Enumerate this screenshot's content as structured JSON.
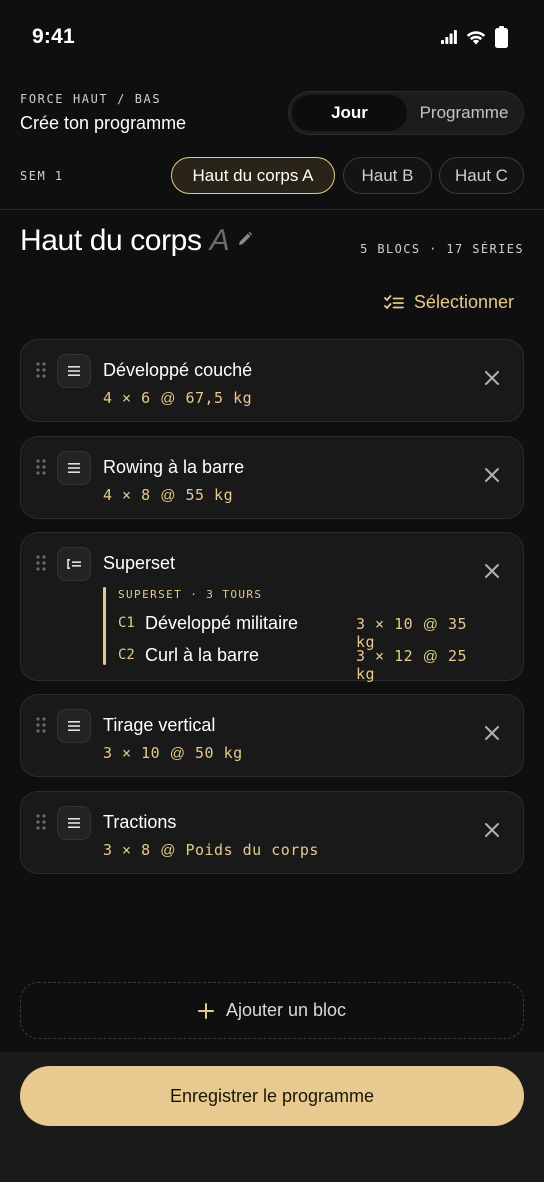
{
  "status": {
    "time": "9:41"
  },
  "header": {
    "eyebrow": "FORCE HAUT / BAS",
    "title": "Crée ton programme",
    "segments": [
      "Jour",
      "Programme"
    ],
    "active_segment": "Jour"
  },
  "week": {
    "label": "SEM 1",
    "days": [
      "Haut du corps A",
      "Haut B",
      "Haut C"
    ],
    "active_day": "Haut du corps A"
  },
  "day": {
    "title": "Haut du corps",
    "suffix": "A",
    "stats": "5 BLOCS · 17 SÉRIES"
  },
  "select_label": "Sélectionner",
  "blocks": [
    {
      "type": "exercise",
      "name": "Développé couché",
      "sets": "4 × 6",
      "at": "@",
      "load": "67,5 kg"
    },
    {
      "type": "exercise",
      "name": "Rowing à la barre",
      "sets": "4 × 8",
      "at": "@",
      "load": "55 kg"
    },
    {
      "type": "superset",
      "name": "Superset",
      "label": "SUPERSET · 3 TOURS",
      "items": [
        {
          "code": "C1",
          "name": "Développé militaire",
          "sets": "3 × 10",
          "at": "@",
          "load": "35 kg"
        },
        {
          "code": "C2",
          "name": "Curl à la barre",
          "sets": "3 × 12",
          "at": "@",
          "load": "25 kg"
        }
      ]
    },
    {
      "type": "exercise",
      "name": "Tirage vertical",
      "sets": "3 × 10",
      "at": "@",
      "load": "50 kg"
    },
    {
      "type": "exercise",
      "name": "Tractions",
      "sets": "3 × 8",
      "at": "@",
      "load": "Poids du corps"
    }
  ],
  "add_block_label": "Ajouter un bloc",
  "save_label": "Enregistrer le programme",
  "colors": {
    "accent": "#e6c98c",
    "background": "#0f0f0f",
    "card": "#191919"
  }
}
